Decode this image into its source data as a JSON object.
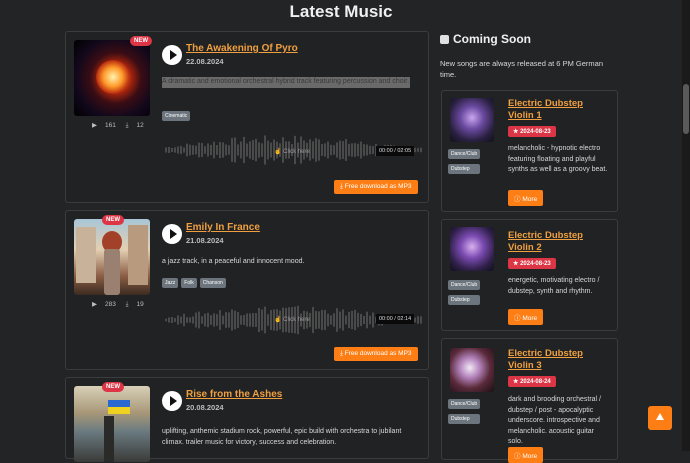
{
  "page": {
    "title": "Latest Music"
  },
  "songs": [
    {
      "badge": "NEW",
      "title": "The Awakening Of Pyro",
      "date": "22.08.2024",
      "description": "A dramatic and emotional orchestral hybrid track featuring percussion and choir.",
      "tags": [
        "Cinematic"
      ],
      "plays": "161",
      "downloads": "12",
      "waveform_hint": "Click here",
      "time_current": "00:00",
      "time_total": "02:05",
      "download_label": "Free download as MP3"
    },
    {
      "badge": "NEW",
      "title": "Emily In France",
      "date": "21.08.2024",
      "description": "a jazz track, in a peaceful and innocent mood.",
      "tags": [
        "Jazz",
        "Folk",
        "Chanson"
      ],
      "plays": "283",
      "downloads": "19",
      "waveform_hint": "Click here",
      "time_current": "00:00",
      "time_total": "02:14",
      "download_label": "Free download as MP3"
    },
    {
      "badge": "NEW",
      "title": "Rise from the Ashes",
      "date": "20.08.2024",
      "description": "uplifting, anthemic stadium rock, powerful, epic build with orchestra to jubilant climax. trailer music for victory, success and celebration."
    }
  ],
  "coming_soon": {
    "heading": "Coming Soon",
    "note": "New songs are always released at 6 PM German time.",
    "items": [
      {
        "title": "Electric Dubstep Violin 1",
        "date": "2024-08-23",
        "tags": [
          "Dance/Club",
          "Dubstep"
        ],
        "description": "melancholic - hypnotic electro featuring floating and playful synths as well as a groovy beat.",
        "more_label": "More"
      },
      {
        "title": "Electric Dubstep Violin 2",
        "date": "2024-08-23",
        "tags": [
          "Dance/Club",
          "Dubstep"
        ],
        "description": "energetic, motivating electro / dubstep, synth and rhythm.",
        "more_label": "More"
      },
      {
        "title": "Electric Dubstep Violin 3",
        "date": "2024-08-24",
        "tags": [
          "Dance/Club",
          "Dubstep"
        ],
        "description": "dark and brooding orchestral / dubstep / post - apocalyptic underscore. introspective and melancholic. acoustic guitar solo.",
        "more_label": "More"
      }
    ]
  },
  "icons": {
    "play": "play-icon",
    "plays_count": "play-count-icon",
    "downloads_count": "download-count-icon",
    "download": "download-icon",
    "info": "info-icon",
    "star": "star-icon",
    "scroll_top": "arrow-up-icon"
  },
  "colors": {
    "background": "#222426",
    "accent": "#fd7e14",
    "link": "#f0a040",
    "badge": "#dc3545",
    "tag": "#6c757d"
  }
}
